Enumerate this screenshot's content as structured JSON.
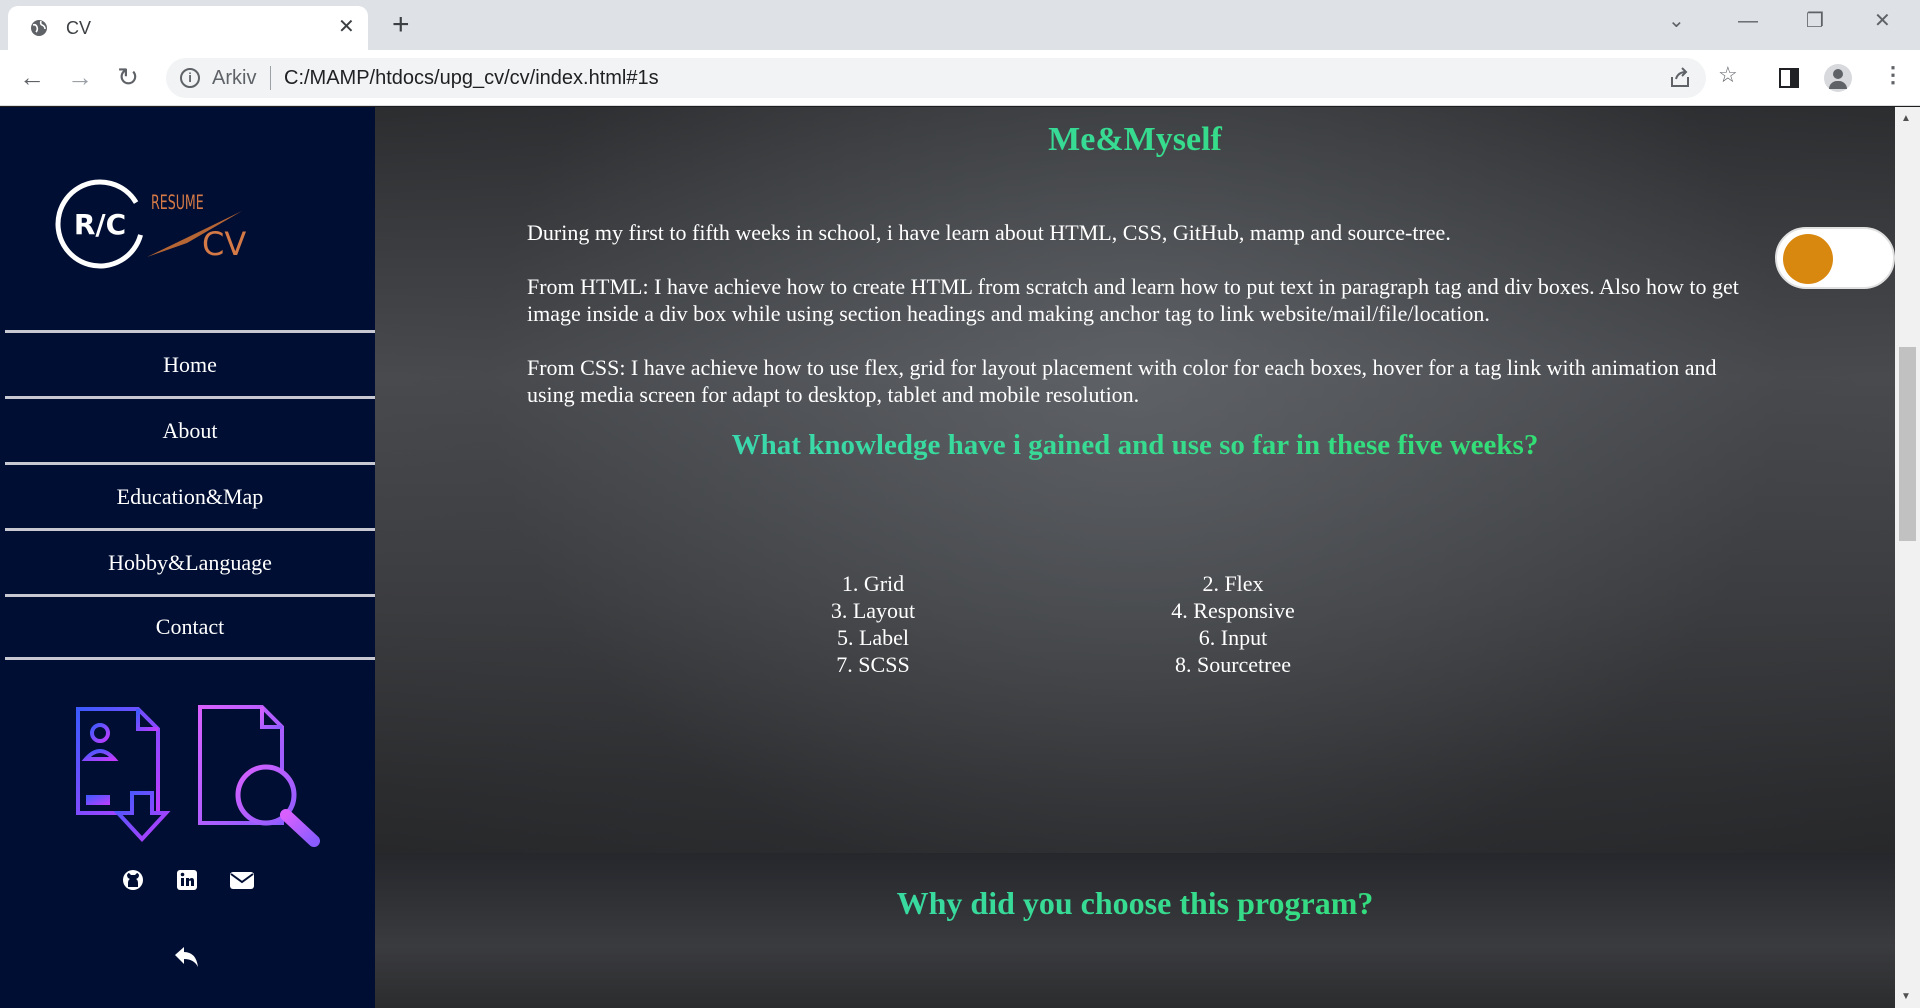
{
  "browser": {
    "tab_title": "CV",
    "close_glyph": "✕",
    "new_tab_glyph": "+",
    "security_label": "Arkiv",
    "url": "C:/MAMP/htdocs/upg_cv/cv/index.html#1s",
    "icons": [
      "globe-icon",
      "back-icon",
      "forward-icon",
      "reload-icon",
      "info-icon",
      "share-icon",
      "star-icon",
      "sidepanel-icon",
      "profile-icon",
      "menu-icon"
    ]
  },
  "sidebar": {
    "logo": {
      "main": "R/C",
      "resume": "RESUME",
      "cv": "CV"
    },
    "nav": [
      {
        "label": "Home"
      },
      {
        "label": "About"
      },
      {
        "label": "Education&Map"
      },
      {
        "label": "Hobby&Language"
      },
      {
        "label": "Contact"
      }
    ],
    "social_icons": [
      "github-icon",
      "linkedin-icon",
      "mail-icon"
    ],
    "colors": {
      "background": "#000e33",
      "accent": "#d9880f"
    }
  },
  "main": {
    "section1_title": "Me&Myself",
    "para1": "During my first to fifth weeks in school, i have learn about HTML, CSS, GitHub, mamp and source-tree.",
    "para2": "From HTML: I have achieve how to create HTML from scratch and learn how to put text in paragraph tag and div boxes. Also how to get image inside a div box while using section headings and making anchor tag to link website/mail/file/location.",
    "para3": "From CSS: I have achieve how to use flex, grid for layout placement with color for each boxes, hover for a tag link with animation and using media screen for adapt to desktop, tablet and mobile resolution.",
    "knowledge_title": "What knowledge have i gained and use so far in these five weeks?",
    "knowledge_items": [
      "1. Grid",
      "2. Flex",
      "3. Layout",
      "4. Responsive",
      "5. Label",
      "6. Input",
      "7. SCSS",
      "8. Sourcetree"
    ],
    "section2_title": "Why did you choose this program?",
    "toggle_state": "off"
  }
}
